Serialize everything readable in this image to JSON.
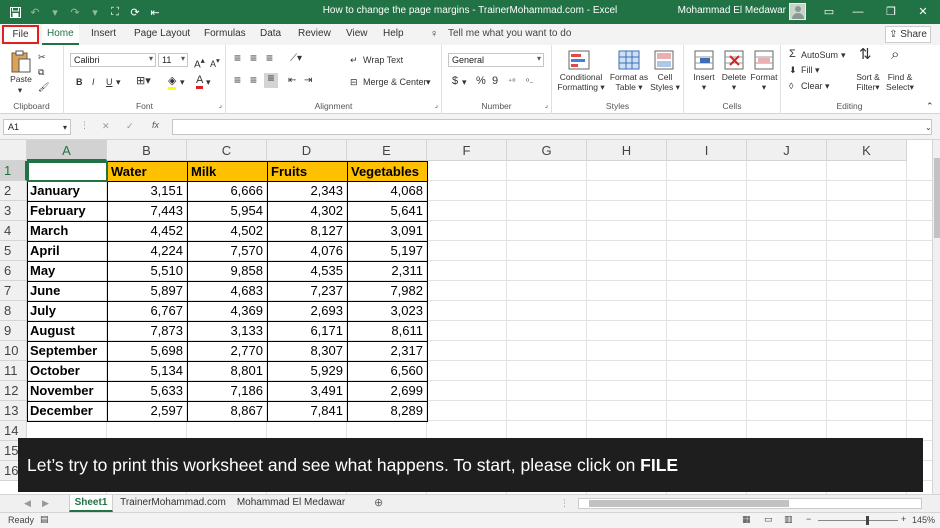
{
  "window": {
    "title": "How to change the page margins - TrainerMohammad.com  -  Excel",
    "user": "Mohammad El Medawar"
  },
  "ribbon_tabs": [
    "File",
    "Home",
    "Insert",
    "Page Layout",
    "Formulas",
    "Data",
    "Review",
    "View",
    "Help"
  ],
  "tell_me": "Tell me what you want to do",
  "share_label": "Share",
  "ribbon": {
    "clipboard": {
      "label": "Clipboard",
      "paste": "Paste"
    },
    "font": {
      "label": "Font",
      "name": "Calibri",
      "size": "11",
      "bold": "B",
      "italic": "I",
      "underline": "U"
    },
    "alignment": {
      "label": "Alignment",
      "wrap_text": "Wrap Text",
      "merge_center": "Merge & Center"
    },
    "number": {
      "label": "Number",
      "format": "General",
      "currency": "$",
      "percent": "%",
      "comma": "9"
    },
    "styles": {
      "label": "Styles",
      "conditional": "Conditional",
      "conditional2": "Formatting",
      "format_as": "Format as",
      "format_as2": "Table",
      "cell": "Cell",
      "cell2": "Styles"
    },
    "cells": {
      "label": "Cells",
      "insert": "Insert",
      "delete": "Delete",
      "format": "Format"
    },
    "editing": {
      "label": "Editing",
      "autosum": "AutoSum",
      "fill": "Fill",
      "clear": "Clear",
      "sort": "Sort &",
      "sort2": "Filter",
      "find": "Find &",
      "find2": "Select"
    }
  },
  "name_box": "A1",
  "fx": "fx",
  "columns": [
    "A",
    "B",
    "C",
    "D",
    "E",
    "F",
    "G",
    "H",
    "I",
    "J",
    "K"
  ],
  "rows": [
    "1",
    "2",
    "3",
    "4",
    "5",
    "6",
    "7",
    "8",
    "9",
    "10",
    "11",
    "12",
    "13",
    "14",
    "15",
    "16"
  ],
  "table": {
    "headers": [
      "Water",
      "Milk",
      "Fruits",
      "Vegetables"
    ],
    "data": [
      [
        "January",
        "3,151",
        "6,666",
        "2,343",
        "4,068"
      ],
      [
        "February",
        "7,443",
        "5,954",
        "4,302",
        "5,641"
      ],
      [
        "March",
        "4,452",
        "4,502",
        "8,127",
        "3,091"
      ],
      [
        "April",
        "4,224",
        "7,570",
        "4,076",
        "5,197"
      ],
      [
        "May",
        "5,510",
        "9,858",
        "4,535",
        "2,311"
      ],
      [
        "June",
        "5,897",
        "4,683",
        "7,237",
        "7,982"
      ],
      [
        "July",
        "6,767",
        "4,369",
        "2,693",
        "3,023"
      ],
      [
        "August",
        "7,873",
        "3,133",
        "6,171",
        "8,611"
      ],
      [
        "September",
        "5,698",
        "2,770",
        "8,307",
        "2,317"
      ],
      [
        "October",
        "5,134",
        "8,801",
        "5,929",
        "6,560"
      ],
      [
        "November",
        "5,633",
        "7,186",
        "3,491",
        "2,699"
      ],
      [
        "December",
        "2,597",
        "8,867",
        "7,841",
        "8,289"
      ]
    ]
  },
  "caption": {
    "text": "Let’s try to print this worksheet and see what happens. To start, please click on ",
    "emphasis": "FILE"
  },
  "sheets": [
    "Sheet1",
    "TrainerMohammad.com",
    "Mohammad El Medawar"
  ],
  "status": {
    "ready": "Ready",
    "zoom": "145%"
  },
  "colors": {
    "accent": "#217346",
    "header_fill": "#ffc000",
    "highlight_border": "#e02020"
  }
}
